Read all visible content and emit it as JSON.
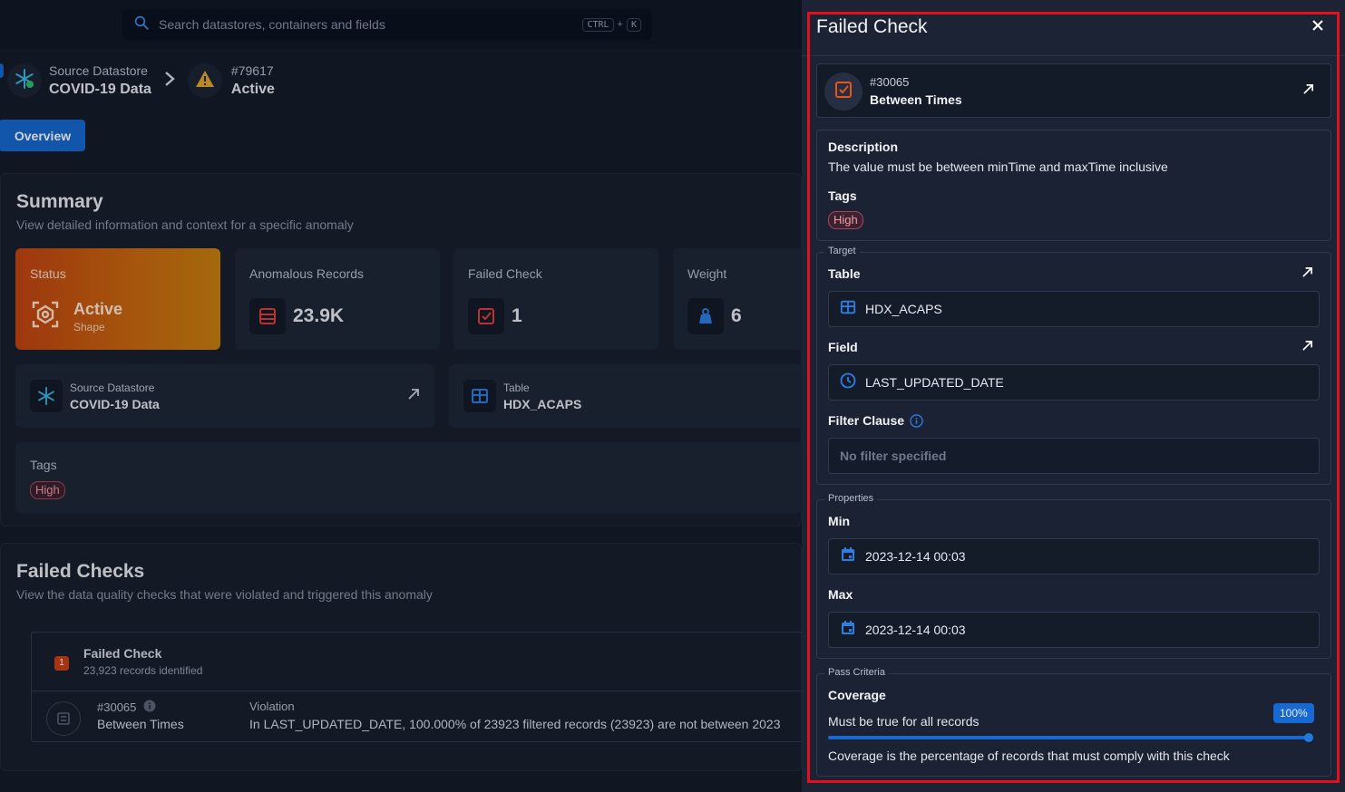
{
  "topbar": {
    "search_placeholder": "Search datastores, containers and fields",
    "kbd_ctrl": "CTRL",
    "kbd_plus": "+",
    "kbd_k": "K"
  },
  "breadcrumb": {
    "datastore_label": "Source Datastore",
    "datastore_name": "COVID-19 Data",
    "anomaly_id": "#79617",
    "anomaly_status": "Active"
  },
  "tabs": {
    "overview": "Overview"
  },
  "summary": {
    "title": "Summary",
    "subtitle": "View detailed information and context for a specific anomaly",
    "status_label": "Status",
    "status_value": "Active",
    "status_sub": "Shape",
    "anomalous_label": "Anomalous Records",
    "anomalous_value": "23.9K",
    "failed_label": "Failed Check",
    "failed_value": "1",
    "weight_label": "Weight",
    "weight_value": "6",
    "source_small": "Source Datastore",
    "source_big": "COVID-19 Data",
    "table_small": "Table",
    "table_big": "HDX_ACAPS",
    "tags_label": "Tags",
    "tag": "High"
  },
  "failed_checks": {
    "title": "Failed Checks",
    "subtitle": "View the data quality checks that were violated and triggered this anomaly",
    "badge": "1",
    "head_title": "Failed Check",
    "head_sub": "23,923 records identified",
    "row_id": "#30065",
    "row_name": "Between Times",
    "violation_label": "Violation",
    "violation_text": "In LAST_UPDATED_DATE, 100.000% of 23923 filtered records (23923) are not between 2023"
  },
  "drawer": {
    "title": "Failed Check",
    "check_id": "#30065",
    "check_name": "Between Times",
    "description_label": "Description",
    "description_text": "The value must be between minTime and maxTime inclusive",
    "tags_label": "Tags",
    "tag": "High",
    "target_legend": "Target",
    "table_label": "Table",
    "table_value": "HDX_ACAPS",
    "field_label": "Field",
    "field_value": "LAST_UPDATED_DATE",
    "filter_label": "Filter Clause",
    "filter_placeholder": "No filter specified",
    "properties_legend": "Properties",
    "min_label": "Min",
    "min_value": "2023-12-14 00:03",
    "max_label": "Max",
    "max_value": "2023-12-14 00:03",
    "pass_legend": "Pass Criteria",
    "coverage_label": "Coverage",
    "coverage_text": "Must be true for all records",
    "coverage_pct": "100%",
    "coverage_fraction": 1.0,
    "coverage_help": "Coverage is the percentage of records that must comply with this check"
  },
  "colors": {
    "accent": "#1769d1",
    "highlight": "#e3101b",
    "status_gradient_start": "#c14412",
    "status_gradient_end": "#c9800f",
    "tag_high": "#f29aa1"
  },
  "icons": [
    "search-icon",
    "snowflake-icon",
    "chevron-right-icon",
    "warning-icon",
    "shape-icon",
    "records-icon",
    "check-icon",
    "weight-icon",
    "table-icon",
    "external-link-icon",
    "info-icon",
    "clock-icon",
    "calendar-icon",
    "close-icon"
  ]
}
